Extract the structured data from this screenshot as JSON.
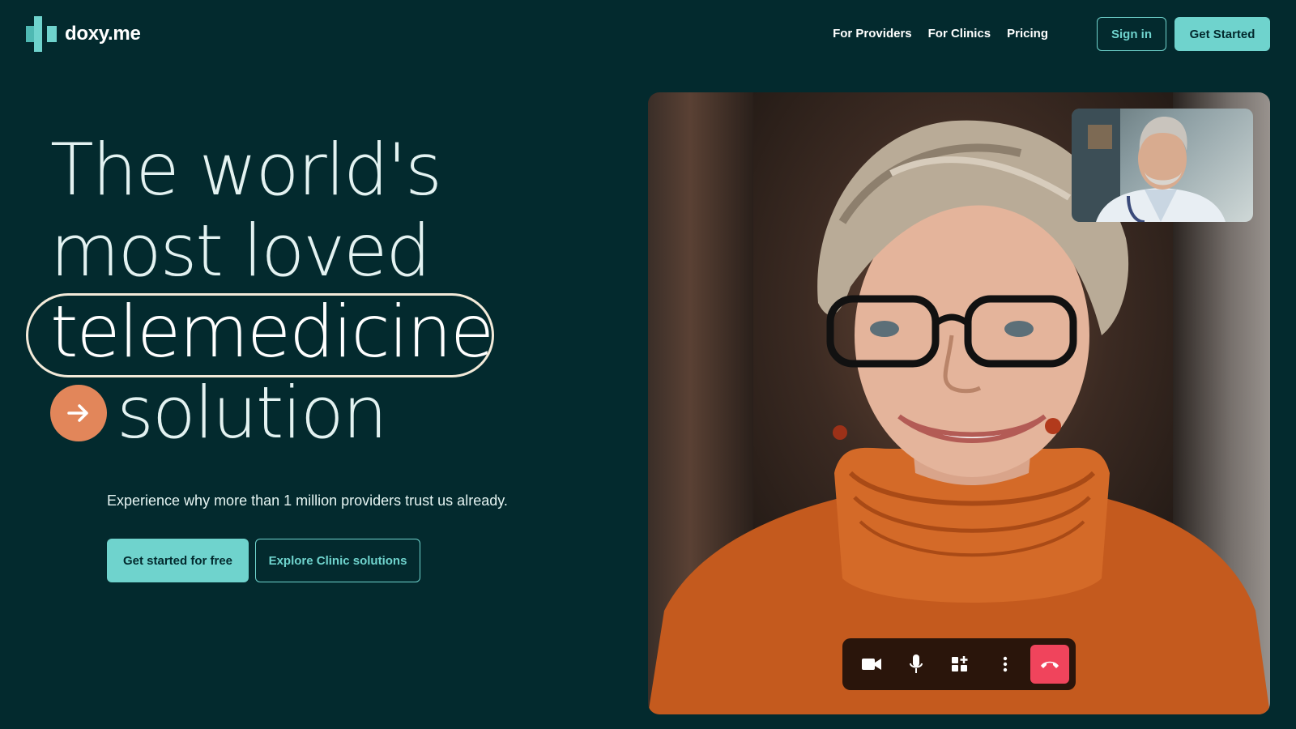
{
  "brand": {
    "name": "doxy.me",
    "accent": "#6fd3cd",
    "background": "#032a2e"
  },
  "nav": {
    "links": [
      "For Providers",
      "For Clinics",
      "Pricing"
    ],
    "sign_in": "Sign in",
    "get_started": "Get Started"
  },
  "hero": {
    "line1": "The world's",
    "line2": "most loved",
    "line3": "telemedicine",
    "line4": "solution",
    "subtitle": "Experience why more than 1 million providers trust us already.",
    "cta_primary": "Get started for free",
    "cta_secondary": "Explore Clinic solutions",
    "arrow_color": "#e2865a"
  },
  "video_call": {
    "controls": [
      "camera-icon",
      "microphone-icon",
      "add-app-icon",
      "more-options-icon",
      "end-call-icon"
    ],
    "end_call_color": "#f0445c"
  }
}
